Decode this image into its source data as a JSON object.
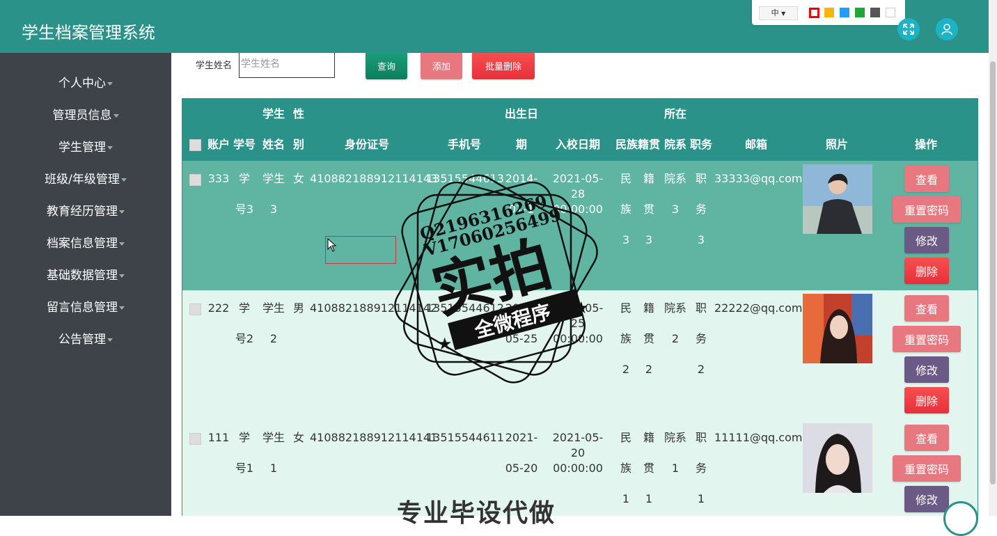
{
  "app": {
    "title": "学生档案管理系统"
  },
  "theme": {
    "lang": "中",
    "swatches": [
      "#ee0000",
      "#f5b50a",
      "#1e9fff",
      "#20a53a",
      "#555555",
      "#ffffff"
    ]
  },
  "sidebar": {
    "items": [
      {
        "label": "个人中心"
      },
      {
        "label": "管理员信息"
      },
      {
        "label": "学生管理"
      },
      {
        "label": "班级/年级管理"
      },
      {
        "label": "教育经历管理"
      },
      {
        "label": "档案信息管理"
      },
      {
        "label": "基础数据管理"
      },
      {
        "label": "留言信息管理"
      },
      {
        "label": "公告管理"
      }
    ]
  },
  "search": {
    "label": "学生姓名",
    "placeholder": "学生姓名",
    "query_label": "查询",
    "add_label": "添加",
    "batch_delete_label": "批量删除"
  },
  "table": {
    "headers": {
      "account": "账户",
      "student_no": "学号",
      "name_1": "学生",
      "name_2": "姓名",
      "gender_1": "性",
      "gender_2": "别",
      "id_card": "身份证号",
      "phone": "手机号",
      "birth_1": "出生日",
      "birth_2": "期",
      "enroll": "入校日期",
      "ethnic": "民族",
      "native": "籍贯",
      "dept_1": "所在",
      "dept_2": "院系",
      "duty": "职务",
      "email": "邮箱",
      "photo": "照片",
      "ops": "操作"
    },
    "rows": [
      {
        "account": "333",
        "student_no_1": "学",
        "student_no_2": "号3",
        "name_1": "学生",
        "name_2": "3",
        "gender": "女",
        "id_card": "410882188912114143",
        "phone": "13515544613",
        "birth_1": "2014-",
        "birth_2": "01-1",
        "enroll_1": "2021-05-28",
        "enroll_2": "00:00:00",
        "ethnic_1": "民",
        "ethnic_2": "族",
        "ethnic_3": "3",
        "native_1": "籍",
        "native_2": "贯",
        "native_3": "3",
        "dept_1": "院系",
        "dept_2": "3",
        "duty_1": "职",
        "duty_2": "务",
        "duty_3": "3",
        "email": "33333@qq.com"
      },
      {
        "account": "222",
        "student_no_1": "学",
        "student_no_2": "号2",
        "name_1": "学生",
        "name_2": "2",
        "gender": "男",
        "id_card": "410882188912114142",
        "phone": "13515544612",
        "birth_1": "2021-",
        "birth_2": "05-25",
        "enroll_1": "2021-05-25",
        "enroll_2": "00:00:00",
        "ethnic_1": "民",
        "ethnic_2": "族",
        "ethnic_3": "2",
        "native_1": "籍",
        "native_2": "贯",
        "native_3": "2",
        "dept_1": "院系",
        "dept_2": "2",
        "duty_1": "职",
        "duty_2": "务",
        "duty_3": "2",
        "email": "22222@qq.com"
      },
      {
        "account": "111",
        "student_no_1": "学",
        "student_no_2": "号1",
        "name_1": "学生",
        "name_2": "1",
        "gender": "女",
        "id_card": "410882188912114141",
        "phone": "13515544611",
        "birth_1": "2021-",
        "birth_2": "05-20",
        "enroll_1": "2021-05-20",
        "enroll_2": "00:00:00",
        "ethnic_1": "民",
        "ethnic_2": "族",
        "ethnic_3": "1",
        "native_1": "籍",
        "native_2": "贯",
        "native_3": "1",
        "dept_1": "院系",
        "dept_2": "1",
        "duty_1": "职",
        "duty_2": "务",
        "duty_3": "1",
        "email": "11111@qq.com"
      }
    ],
    "actions": {
      "view": "查看",
      "reset_password": "重置密码",
      "edit": "修改",
      "delete": "删除"
    }
  },
  "watermark": {
    "line1": "Q2196316269",
    "line2": "V17060256499",
    "big": "实拍",
    "ribbon": "全微程序",
    "bottom": "专业毕设代做"
  },
  "colors": {
    "header": "#2a9288",
    "sidebar": "#3e4349",
    "row_selected": "#5fb4a2",
    "row_default": "#e3f5ef",
    "view_btn": "#e8787f",
    "edit_btn": "#6b5a86",
    "delete_btn": "#f03c3c"
  }
}
